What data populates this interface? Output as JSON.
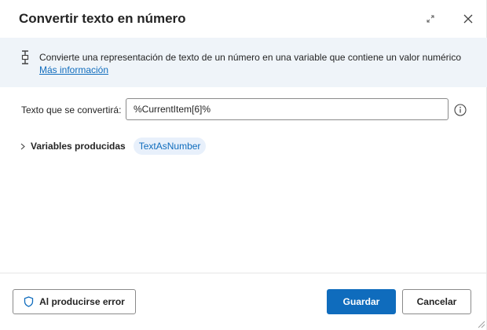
{
  "dialog": {
    "title": "Convertir texto en número",
    "icons": {
      "expand": "expand-icon",
      "close": "close-icon"
    }
  },
  "info": {
    "icon": "variable-icon",
    "description": "Convierte una representación de texto de un número en una variable que contiene un valor numérico",
    "link_label": "Más información"
  },
  "form": {
    "text_label": "Texto que se convertirá:",
    "text_value": "%CurrentItem[6]%",
    "help_icon": "info-circle-icon"
  },
  "variables": {
    "label": "Variables producidas",
    "chevron_icon": "chevron-right-icon",
    "items": [
      "TextAsNumber"
    ]
  },
  "footer": {
    "error_button_label": "Al producirse error",
    "error_icon": "shield-icon",
    "save_label": "Guardar",
    "cancel_label": "Cancelar"
  },
  "colors": {
    "accent": "#0f6cbd",
    "banner_bg": "#eff4f9",
    "chip_bg": "#e8f0fb",
    "text": "#242424"
  }
}
